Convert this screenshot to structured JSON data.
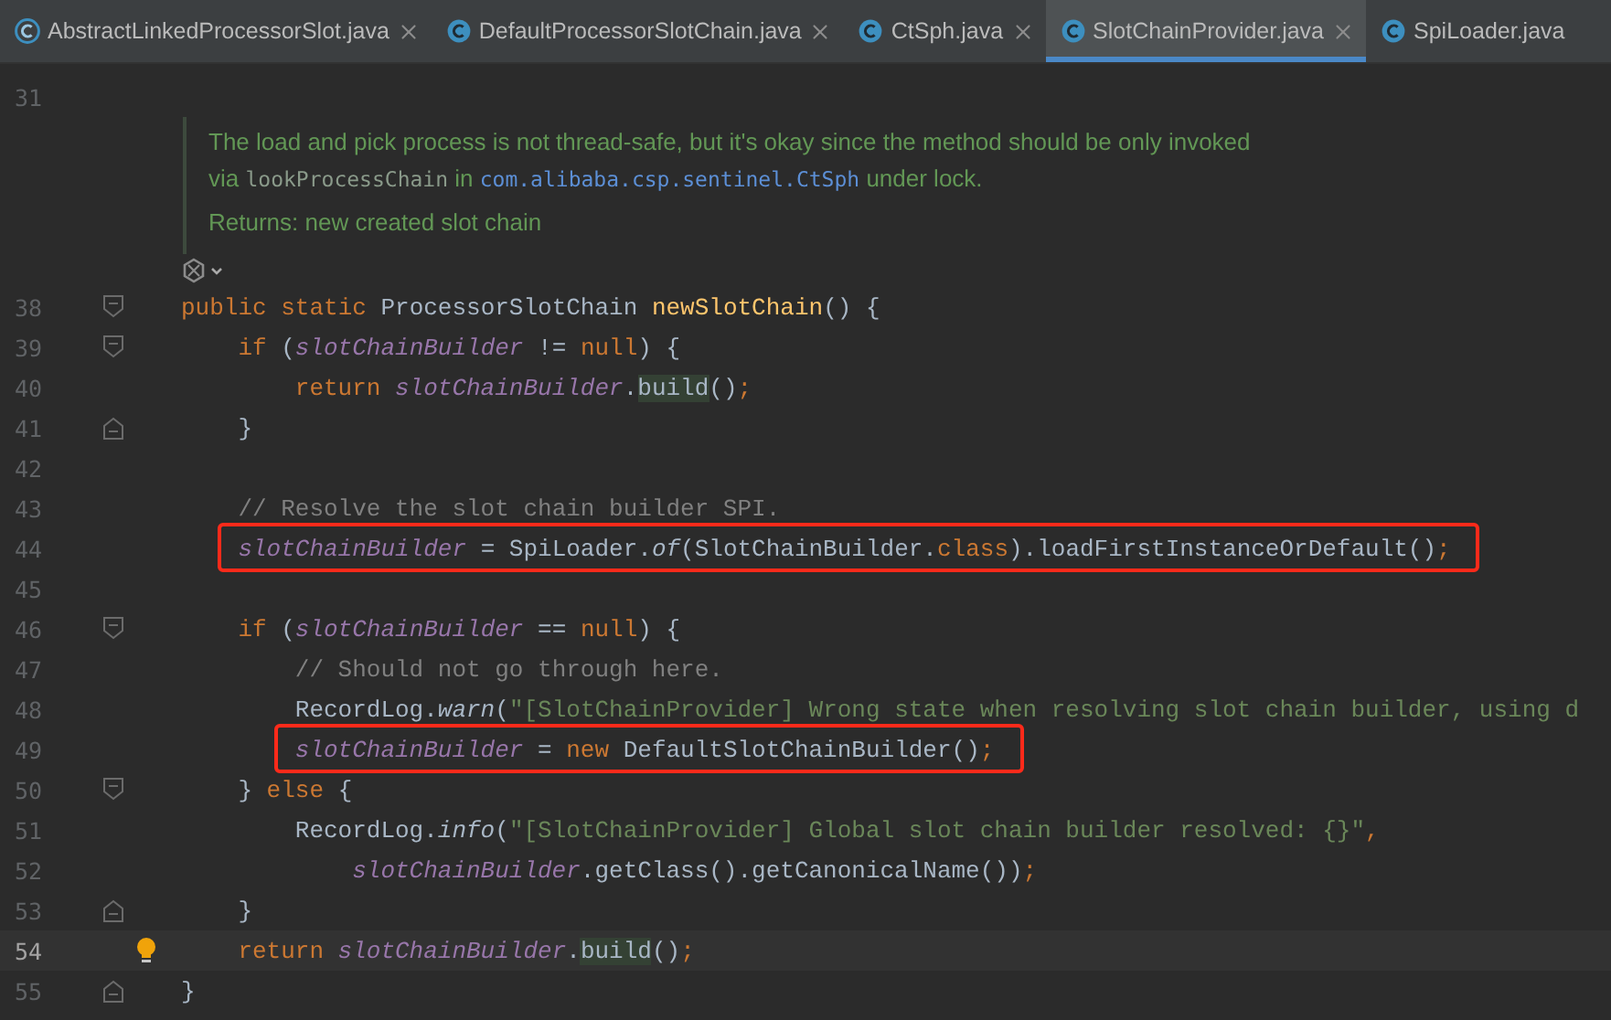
{
  "tabs": [
    {
      "label": "AbstractLinkedProcessorSlot.java",
      "kind": "abstract",
      "selected": false,
      "closable": true
    },
    {
      "label": "DefaultProcessorSlotChain.java",
      "kind": "class",
      "selected": false,
      "closable": true
    },
    {
      "label": "CtSph.java",
      "kind": "class",
      "selected": false,
      "closable": true
    },
    {
      "label": "SlotChainProvider.java",
      "kind": "class",
      "selected": true,
      "closable": true
    },
    {
      "label": "SpiLoader.java",
      "kind": "class",
      "selected": false,
      "closable": false
    }
  ],
  "first_line": {
    "number": "31"
  },
  "doc_comment": {
    "lines": [
      [
        {
          "kind": "text",
          "text": "The load and pick process is not thread-safe, but it's okay since the method should be only invoked"
        }
      ],
      [
        {
          "kind": "text",
          "text": "via "
        },
        {
          "kind": "code",
          "text": "lookProcessChain"
        },
        {
          "kind": "text",
          "text": " in "
        },
        {
          "kind": "link",
          "text": "com.alibaba.csp.sentinel.CtSph"
        },
        {
          "kind": "text",
          "text": " under lock."
        }
      ],
      [
        {
          "kind": "text",
          "text": "Returns: new created slot chain"
        }
      ]
    ]
  },
  "lines": [
    {
      "number": "38",
      "fold_start": true,
      "tokens": [
        {
          "kind": "keyword",
          "text": "public static "
        },
        {
          "kind": "plain",
          "text": "ProcessorSlotChain "
        },
        {
          "kind": "method",
          "text": "newSlotChain"
        },
        {
          "kind": "plain",
          "text": "() {"
        }
      ],
      "children": [
        {
          "number": "39",
          "fold_start": true,
          "tokens": [
            {
              "kind": "keyword",
              "text": "if "
            },
            {
              "kind": "plain",
              "text": "("
            },
            {
              "kind": "field",
              "text": "slotChainBuilder"
            },
            {
              "kind": "plain",
              "text": " != "
            },
            {
              "kind": "keyword",
              "text": "null"
            },
            {
              "kind": "plain",
              "text": ") {"
            }
          ],
          "children": [
            {
              "number": "40",
              "tokens": [
                {
                  "kind": "keyword",
                  "text": "return "
                },
                {
                  "kind": "field",
                  "text": "slotChainBuilder"
                },
                {
                  "kind": "plain",
                  "text": "."
                },
                {
                  "kind": "usage",
                  "text": "build"
                },
                {
                  "kind": "plain",
                  "text": "()"
                },
                {
                  "kind": "keyword",
                  "text": ";"
                }
              ]
            }
          ]
        },
        {
          "number": "41",
          "fold_end": true,
          "tokens": [
            {
              "kind": "plain",
              "text": "}"
            }
          ]
        },
        {
          "number": "42"
        },
        {
          "number": "43",
          "tokens": [
            {
              "kind": "comment",
              "text": "// Resolve the slot chain builder SPI."
            }
          ]
        },
        {
          "number": "44",
          "boxed": true,
          "tokens": [
            {
              "kind": "field",
              "text": "slotChainBuilder"
            },
            {
              "kind": "plain",
              "text": " = SpiLoader."
            },
            {
              "kind": "static",
              "text": "of"
            },
            {
              "kind": "plain",
              "text": "(SlotChainBuilder."
            },
            {
              "kind": "keyword",
              "text": "class"
            },
            {
              "kind": "plain",
              "text": ").loadFirstInstanceOrDefault()"
            },
            {
              "kind": "keyword",
              "text": ";"
            }
          ]
        },
        {
          "number": "45"
        },
        {
          "number": "46",
          "fold_start": true,
          "tokens": [
            {
              "kind": "keyword",
              "text": "if "
            },
            {
              "kind": "plain",
              "text": "("
            },
            {
              "kind": "field",
              "text": "slotChainBuilder"
            },
            {
              "kind": "plain",
              "text": " == "
            },
            {
              "kind": "keyword",
              "text": "null"
            },
            {
              "kind": "plain",
              "text": ") {"
            }
          ],
          "children": [
            {
              "number": "47",
              "tokens": [
                {
                  "kind": "comment",
                  "text": "// Should not go through here."
                }
              ]
            },
            {
              "number": "48",
              "tokens": [
                {
                  "kind": "plain",
                  "text": "RecordLog."
                },
                {
                  "kind": "static",
                  "text": "warn"
                },
                {
                  "kind": "plain",
                  "text": "("
                },
                {
                  "kind": "string",
                  "text": "\"[SlotChainProvider] Wrong state when resolving slot chain builder, using d"
                }
              ]
            },
            {
              "number": "49",
              "boxed": true,
              "tokens": [
                {
                  "kind": "field",
                  "text": "slotChainBuilder"
                },
                {
                  "kind": "plain",
                  "text": " = "
                },
                {
                  "kind": "keyword",
                  "text": "new "
                },
                {
                  "kind": "plain",
                  "text": "DefaultSlotChainBuilder()"
                },
                {
                  "kind": "keyword",
                  "text": ";"
                }
              ]
            }
          ]
        },
        {
          "number": "50",
          "fold_start": true,
          "tokens": [
            {
              "kind": "plain",
              "text": "} "
            },
            {
              "kind": "keyword",
              "text": "else"
            },
            {
              "kind": "plain",
              "text": " {"
            }
          ],
          "children": [
            {
              "number": "51",
              "tokens": [
                {
                  "kind": "plain",
                  "text": "RecordLog."
                },
                {
                  "kind": "static",
                  "text": "info"
                },
                {
                  "kind": "plain",
                  "text": "("
                },
                {
                  "kind": "string",
                  "text": "\"[SlotChainProvider] Global slot chain builder resolved: {}\""
                },
                {
                  "kind": "keyword",
                  "text": ","
                }
              ],
              "children": [
                {
                  "number": "52",
                  "tokens": [
                    {
                      "kind": "field",
                      "text": "slotChainBuilder"
                    },
                    {
                      "kind": "plain",
                      "text": ".getClass().getCanonicalName())"
                    },
                    {
                      "kind": "keyword",
                      "text": ";"
                    }
                  ]
                }
              ]
            }
          ]
        },
        {
          "number": "53",
          "fold_end": true,
          "tokens": [
            {
              "kind": "plain",
              "text": "}"
            }
          ]
        },
        {
          "number": "54",
          "current": true,
          "bulb": true,
          "tokens": [
            {
              "kind": "keyword",
              "text": "return "
            },
            {
              "kind": "field",
              "text": "slotChainBuilder"
            },
            {
              "kind": "plain",
              "text": "."
            },
            {
              "kind": "usage",
              "text": "build"
            },
            {
              "kind": "plain",
              "text": "()"
            },
            {
              "kind": "keyword",
              "text": ";"
            }
          ]
        }
      ]
    },
    {
      "number": "55",
      "fold_end": true,
      "tokens": [
        {
          "kind": "plain",
          "text": "}"
        }
      ]
    }
  ]
}
